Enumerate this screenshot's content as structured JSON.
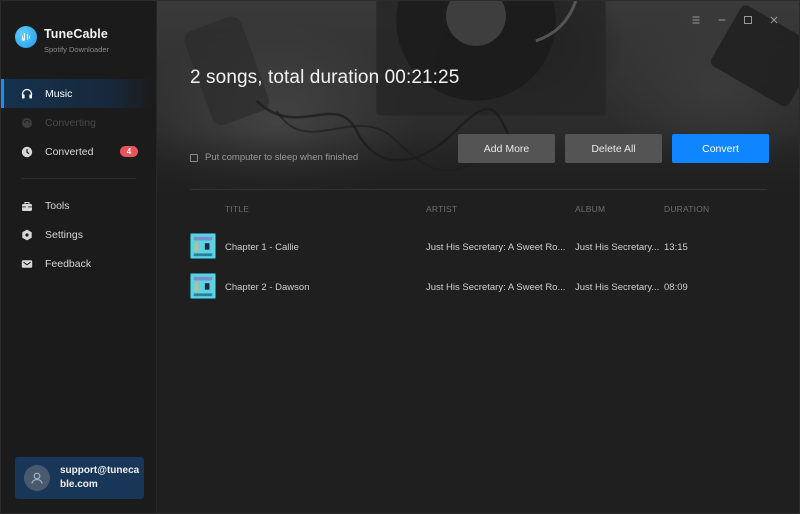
{
  "app": {
    "name": "TuneCable",
    "subtitle": "Spotify Downloader"
  },
  "sidebar": {
    "items": [
      {
        "label": "Music",
        "icon": "headphones-icon",
        "state": "active"
      },
      {
        "label": "Converting",
        "icon": "converting-icon",
        "state": "disabled"
      },
      {
        "label": "Converted",
        "icon": "clock-icon",
        "state": "normal",
        "badge": "4"
      }
    ],
    "items2": [
      {
        "label": "Tools",
        "icon": "toolbox-icon"
      },
      {
        "label": "Settings",
        "icon": "gear-icon"
      },
      {
        "label": "Feedback",
        "icon": "mail-icon"
      }
    ],
    "account": {
      "email": "support@tunecable.com",
      "icon": "user-icon"
    }
  },
  "window_controls": {
    "menu": "menu-icon",
    "minimize": "minimize-icon",
    "maximize": "maximize-icon",
    "close": "close-icon"
  },
  "main": {
    "summary": "2 songs, total duration 00:21:25",
    "sleep_option": {
      "label": "Put computer to sleep when finished",
      "checked": false
    },
    "buttons": {
      "add_more": "Add More",
      "delete_all": "Delete All",
      "convert": "Convert"
    },
    "colors": {
      "accent": "#0f85ff",
      "badge": "#e8545c",
      "active_nav": "#16324f",
      "account_bg": "#183658"
    },
    "table": {
      "headers": {
        "title": "TITLE",
        "artist": "ARTIST",
        "album": "ALBUM",
        "duration": "DURATION"
      },
      "rows": [
        {
          "title": "Chapter 1 - Callie",
          "artist": "Just His Secretary: A Sweet Ro...",
          "album": "Just His Secretary...",
          "duration": "13:15"
        },
        {
          "title": "Chapter 2 - Dawson",
          "artist": "Just His Secretary: A Sweet Ro...",
          "album": "Just His Secretary...",
          "duration": "08:09"
        }
      ]
    }
  }
}
